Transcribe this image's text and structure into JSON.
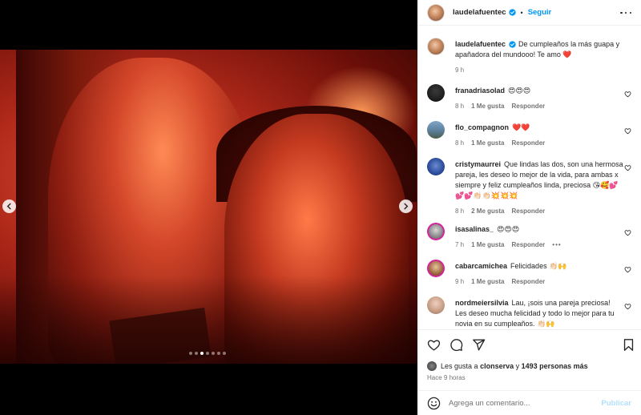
{
  "post": {
    "username": "laudelafuentec",
    "follow_label": "Seguir",
    "separator": "•",
    "caption_user": "laudelafuentec",
    "caption_text": "De cumpleaños la más guapa y apañadora del mundooo! Te amo ❤️",
    "caption_time": "9 h",
    "carousel": {
      "total": 7,
      "current": 3
    }
  },
  "comments": [
    {
      "user": "franadriasolad",
      "text": "😍😍😍",
      "time": "8 h",
      "likes": "1 Me gusta",
      "reply": "Responder"
    },
    {
      "user": "flo_compagnon",
      "text": "❤️❤️",
      "time": "8 h",
      "likes": "1 Me gusta",
      "reply": "Responder"
    },
    {
      "user": "cristymaurrei",
      "text": "Que lindas las dos, son una hermosa pareja, les deseo lo mejor de la vida, para ambas x siempre y feliz cumpleaños linda, preciosa 😘🥰💕💕💕👏🏻👏🏻💥💥💥",
      "time": "8 h",
      "likes": "2 Me gusta",
      "reply": "Responder"
    },
    {
      "user": "isasalinas_",
      "text": "😍😍😍",
      "time": "7 h",
      "likes": "1 Me gusta",
      "reply": "Responder",
      "more": "•••"
    },
    {
      "user": "cabarcamichea",
      "text": "Felicidades 👏🏻🙌",
      "time": "9 h",
      "likes": "1 Me gusta",
      "reply": "Responder"
    },
    {
      "user": "nordmeiersilvia",
      "text": "Lau, ¡sois una pareja preciosa! Les deseo mucha felicidad y todo lo mejor para tu novia en su cumpleaños. 👏🏻🙌",
      "time": "",
      "likes": "",
      "reply": ""
    }
  ],
  "footer": {
    "likes_prefix": "Les gusta a",
    "likes_user": "clonserva",
    "likes_middle": "y",
    "likes_count": "1493 personas más",
    "time_ago": "Hace 9 horas"
  },
  "composer": {
    "placeholder": "Agrega un comentario...",
    "publish_label": "Publicar"
  },
  "colors": {
    "accent": "#0095f6",
    "publish_disabled": "#b2dffc",
    "muted": "#737373",
    "verified": "#0095f6"
  },
  "icons": [
    "chevron-left-icon",
    "chevron-right-icon",
    "verified-icon",
    "more-icon",
    "heart-icon",
    "comment-icon",
    "share-icon",
    "save-icon",
    "emoji-icon"
  ]
}
